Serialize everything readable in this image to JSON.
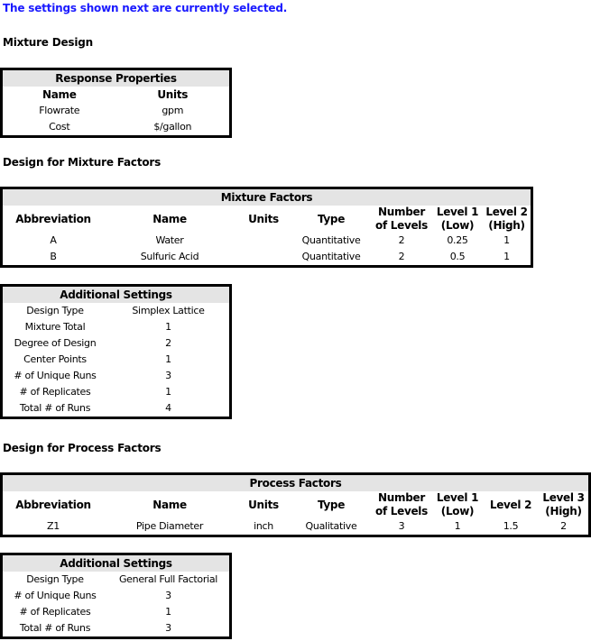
{
  "intro": "The settings shown next are currently selected.",
  "mixture_design": {
    "title": "Mixture Design",
    "response_properties": {
      "caption": "Response Properties",
      "columns": [
        "Name",
        "Units"
      ],
      "rows": [
        [
          "Flowrate",
          "gpm"
        ],
        [
          "Cost",
          "$/gallon"
        ]
      ]
    }
  },
  "mixture_factors_section": {
    "title": "Design for Mixture Factors",
    "factors_table": {
      "caption": "Mixture Factors",
      "columns": [
        "Abbreviation",
        "Name",
        "Units",
        "Type",
        "Number of Levels",
        "Level 1 (Low)",
        "Level 2 (High)"
      ],
      "rows": [
        [
          "A",
          "Water",
          "",
          "Quantitative",
          "2",
          "0.25",
          "1"
        ],
        [
          "B",
          "Sulfuric Acid",
          "",
          "Quantitative",
          "2",
          "0.5",
          "1"
        ]
      ]
    },
    "additional_settings": {
      "caption": "Additional Settings",
      "rows": [
        [
          "Design Type",
          "Simplex Lattice"
        ],
        [
          "Mixture Total",
          "1"
        ],
        [
          "Degree of Design",
          "2"
        ],
        [
          "Center Points",
          "1"
        ],
        [
          "# of Unique Runs",
          "3"
        ],
        [
          "# of Replicates",
          "1"
        ],
        [
          "Total # of Runs",
          "4"
        ]
      ]
    }
  },
  "process_factors_section": {
    "title": "Design for Process Factors",
    "factors_table": {
      "caption": "Process Factors",
      "columns": [
        "Abbreviation",
        "Name",
        "Units",
        "Type",
        "Number of Levels",
        "Level 1 (Low)",
        "Level 2",
        "Level 3 (High)"
      ],
      "rows": [
        [
          "Z1",
          "Pipe Diameter",
          "inch",
          "Qualitative",
          "3",
          "1",
          "1.5",
          "2"
        ]
      ]
    },
    "additional_settings": {
      "caption": "Additional Settings",
      "rows": [
        [
          "Design Type",
          "General Full Factorial"
        ],
        [
          "# of Unique Runs",
          "3"
        ],
        [
          "# of Replicates",
          "1"
        ],
        [
          "Total # of Runs",
          "3"
        ]
      ]
    }
  }
}
